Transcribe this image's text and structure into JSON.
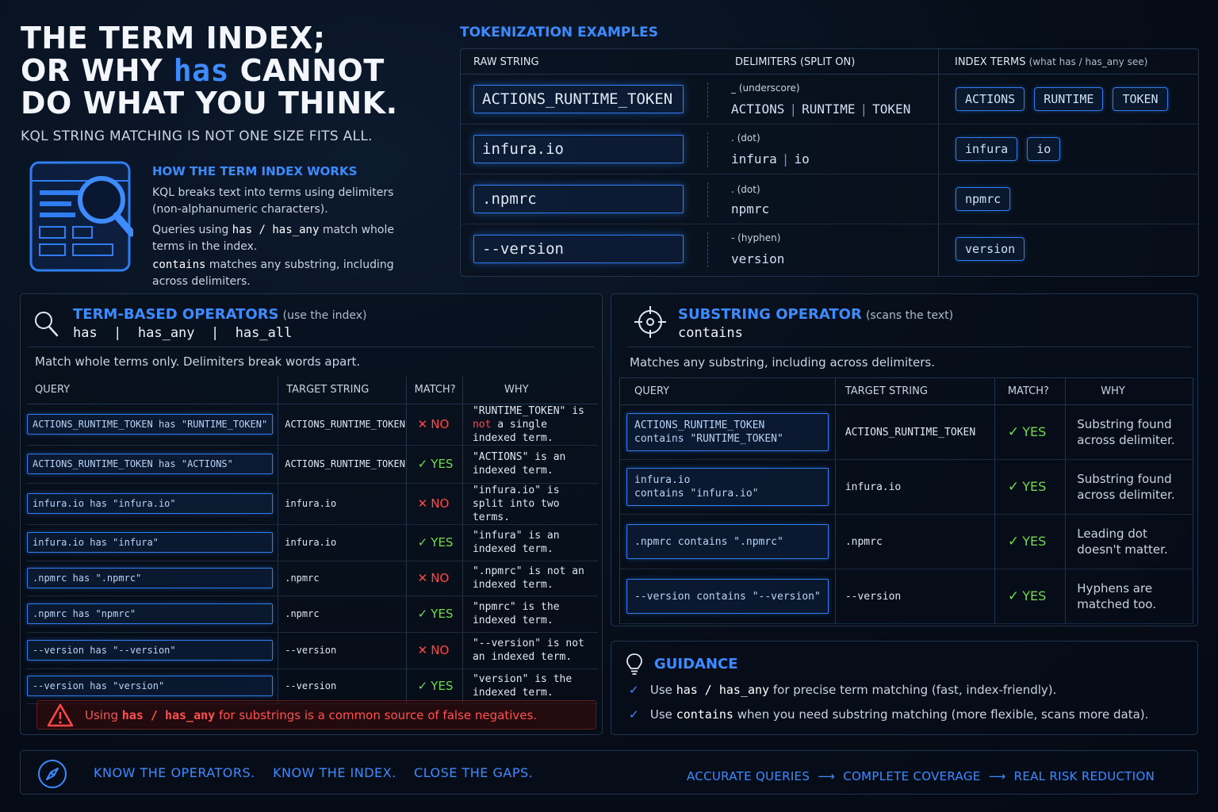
{
  "header": {
    "title_line1": "THE TERM INDEX;",
    "title_line2_pre": "OR WHY ",
    "title_line2_hl": "has",
    "title_line2_post": " CANNOT",
    "title_line3": "DO WHAT YOU THINK.",
    "subtitle": "KQL STRING MATCHING IS NOT ONE SIZE FITS ALL."
  },
  "how_it_works": {
    "title": "HOW THE TERM INDEX WORKS",
    "p1": "KQL breaks text into terms using delimiters (non-alphanumeric characters).",
    "p2_pre": "Queries using ",
    "p2_code1": "has",
    "p2_sep": " / ",
    "p2_code2": "has_any",
    "p2_post": " match whole terms in the index.",
    "p3_code": "contains",
    "p3_post": " matches any substring, including across delimiters."
  },
  "tokenization": {
    "title": "TOKENIZATION EXAMPLES",
    "col_raw": "RAW STRING",
    "col_delim": "DELIMITERS",
    "col_delim_note": "(SPLIT ON)",
    "col_terms": "INDEX TERMS",
    "col_terms_note": "(what has / has_any see)",
    "rows": [
      {
        "raw": "ACTIONS_RUNTIME_TOKEN",
        "delim": "_ (underscore)",
        "parts": [
          "ACTIONS",
          "RUNTIME",
          "TOKEN"
        ],
        "terms": [
          "ACTIONS",
          "RUNTIME",
          "TOKEN"
        ]
      },
      {
        "raw": "infura.io",
        "delim": ". (dot)",
        "parts": [
          "infura",
          "io"
        ],
        "terms": [
          "infura",
          "io"
        ]
      },
      {
        "raw": ".npmrc",
        "delim": ". (dot)",
        "parts": [
          "npmrc"
        ],
        "terms": [
          "npmrc"
        ]
      },
      {
        "raw": "--version",
        "delim": "- (hyphen)",
        "parts": [
          "version"
        ],
        "terms": [
          "version"
        ]
      }
    ]
  },
  "term_ops": {
    "title": "TERM-BASED OPERATORS",
    "note": "(use the index)",
    "ops": "has  |  has_any  |  has_all",
    "desc": "Match whole terms only. Delimiters break words apart.",
    "cols": [
      "QUERY",
      "TARGET STRING",
      "MATCH?",
      "WHY"
    ],
    "rows": [
      {
        "query": "ACTIONS_RUNTIME_TOKEN has \"RUNTIME_TOKEN\"",
        "target": "ACTIONS_RUNTIME_TOKEN",
        "match": "NO",
        "why": "\"RUNTIME_TOKEN\" is not a single indexed term."
      },
      {
        "query": "ACTIONS_RUNTIME_TOKEN has \"ACTIONS\"",
        "target": "ACTIONS_RUNTIME_TOKEN",
        "match": "YES",
        "why": "\"ACTIONS\" is an indexed term."
      },
      {
        "query": "infura.io has \"infura.io\"",
        "target": "infura.io",
        "match": "NO",
        "why": "\"infura.io\" is split into two terms."
      },
      {
        "query": "infura.io has \"infura\"",
        "target": "infura.io",
        "match": "YES",
        "why": "\"infura\" is an indexed term."
      },
      {
        "query": ".npmrc has \".npmrc\"",
        "target": ".npmrc",
        "match": "NO",
        "why": "\".npmrc\" is not an indexed term."
      },
      {
        "query": ".npmrc has \"npmrc\"",
        "target": ".npmrc",
        "match": "YES",
        "why": "\"npmrc\" is the indexed term."
      },
      {
        "query": "--version has \"--version\"",
        "target": "--version",
        "match": "NO",
        "why": "\"--version\" is not an indexed term."
      },
      {
        "query": "--version has \"version\"",
        "target": "--version",
        "match": "YES",
        "why": "\"version\" is the indexed term."
      }
    ],
    "warning_pre": "Using ",
    "warning_code": "has / has_any",
    "warning_post": " for substrings is a common source of false negatives."
  },
  "substring_ops": {
    "title": "SUBSTRING OPERATOR",
    "note": "(scans the text)",
    "ops": "contains",
    "desc": "Matches any substring, including across delimiters.",
    "cols": [
      "QUERY",
      "TARGET STRING",
      "MATCH?",
      "WHY"
    ],
    "rows": [
      {
        "query_l1": "ACTIONS_RUNTIME_TOKEN",
        "query_l2": "contains \"RUNTIME_TOKEN\"",
        "target": "ACTIONS_RUNTIME_TOKEN",
        "match": "YES",
        "why_l1": "Substring found",
        "why_l2": "across delimiter."
      },
      {
        "query_l1": "infura.io",
        "query_l2": "contains \"infura.io\"",
        "target": "infura.io",
        "match": "YES",
        "why_l1": "Substring found",
        "why_l2": "across delimiter."
      },
      {
        "query_l1": ".npmrc contains \".npmrc\"",
        "query_l2": "",
        "target": ".npmrc",
        "match": "YES",
        "why_l1": "Leading dot",
        "why_l2": "doesn't matter."
      },
      {
        "query_l1": "--version contains \"--version\"",
        "query_l2": "",
        "target": "--version",
        "match": "YES",
        "why_l1": "Hyphens are",
        "why_l2": "matched too."
      }
    ]
  },
  "guidance": {
    "title": "GUIDANCE",
    "l1_pre": "Use ",
    "l1_code": "has / has_any",
    "l1_post": " for precise term matching (fast, index-friendly).",
    "l2_pre": "Use ",
    "l2_code": "contains",
    "l2_post": " when you need substring matching (more flexible, scans more data)."
  },
  "footer": {
    "left": [
      "KNOW THE OPERATORS.",
      "KNOW THE INDEX.",
      "CLOSE THE GAPS."
    ],
    "right": [
      "ACCURATE QUERIES",
      "COMPLETE COVERAGE",
      "REAL RISK REDUCTION"
    ]
  },
  "colors": {
    "accent": "#3d8bff",
    "no": "#ff4747",
    "yes": "#6fdc4a",
    "background": "#060d18"
  }
}
